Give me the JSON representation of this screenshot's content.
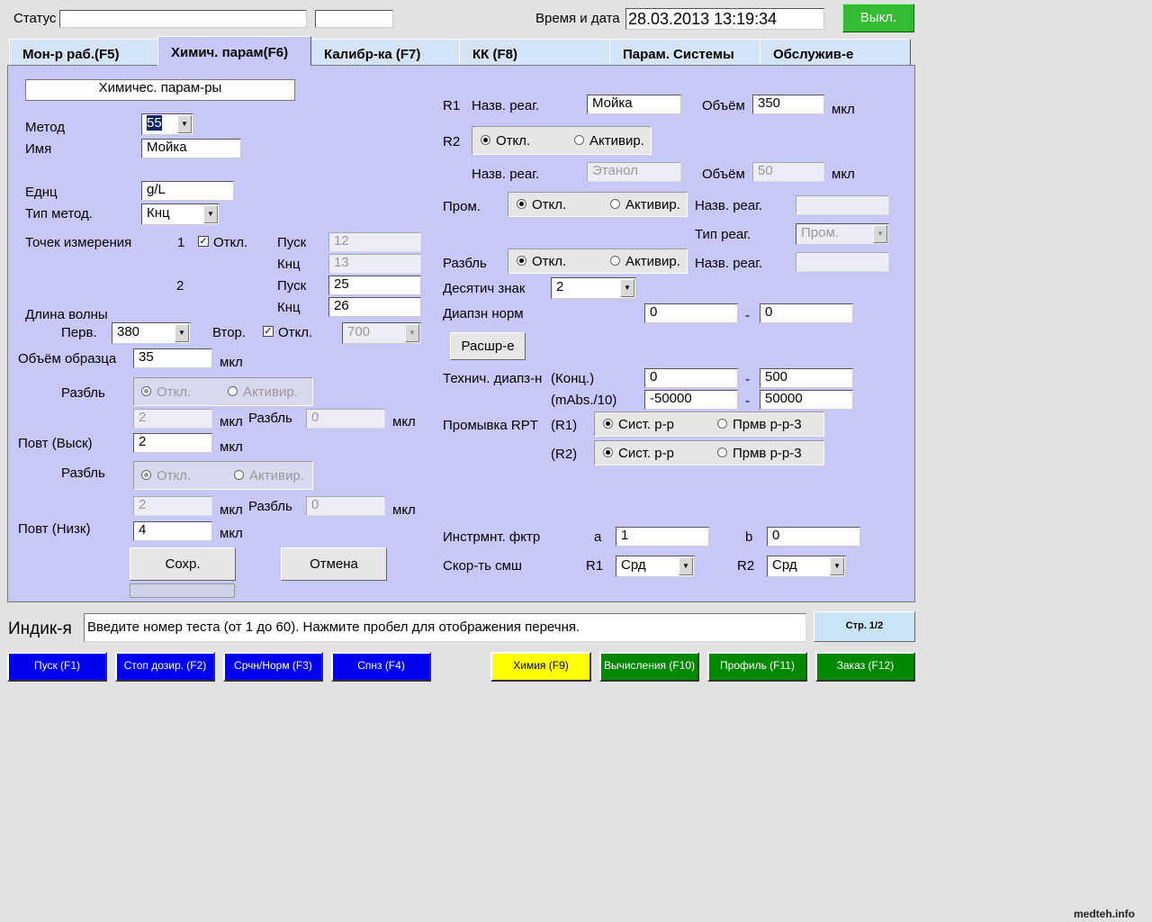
{
  "header": {
    "status_label": "Статус",
    "status_value": "",
    "status_extra": "",
    "datetime_label": "Время и дата",
    "datetime_value": "28.03.2013 13:19:34",
    "power_button": "Выкл."
  },
  "tabs": [
    {
      "label": "Мон-р раб.(F5)"
    },
    {
      "label": "Химич. парам(F6)"
    },
    {
      "label": "Калибр-ка (F7)"
    },
    {
      "label": "КК    (F8)"
    },
    {
      "label": "Парам. Системы"
    },
    {
      "label": "Обслужив-е"
    }
  ],
  "left": {
    "section_title": "Химичес. парам-ры",
    "method_label": "Метод",
    "method_value": "55",
    "name_label": "Имя",
    "name_value": "Мойка",
    "units_label": "Еднц",
    "units_value": "g/L",
    "method_type_label": "Тип метод.",
    "method_type_value": "Кнц",
    "points_label": "Точек измерения",
    "point1": "1",
    "point1_off": "Откл.",
    "start_label": "Пуск",
    "end_label": "Кнц",
    "p1_start": "12",
    "p1_end": "13",
    "point2": "2",
    "p2_start": "25",
    "p2_end": "26",
    "wavelength_label": "Длина волны",
    "primary_label": "Перв.",
    "primary_value": "380",
    "secondary_label": "Втор.",
    "secondary_off": "Откл.",
    "secondary_value": "700",
    "sample_volume_label": "Объём образца",
    "sample_volume_value": "35",
    "unit_ul": "мкл",
    "dilution_label": "Разбль",
    "off": "Откл.",
    "activate": "Активир.",
    "dil1_volume": "2",
    "dil1_dilution": "0",
    "repeat_high_label": "Повт (Выск)",
    "repeat_high_value": "2",
    "dil2_volume": "2",
    "dil2_dilution": "0",
    "repeat_low_label": "Повт (Низк)",
    "repeat_low_value": "4",
    "save_button": "Сохр.",
    "cancel_button": "Отмена"
  },
  "right": {
    "r1_label": "R1",
    "reagent_name_label": "Назв. реаг.",
    "r1_reagent": "Мойка",
    "volume_label": "Объём",
    "r1_volume": "350",
    "unit_ul": "мкл",
    "r2_label": "R2",
    "off": "Откл.",
    "activate": "Активир.",
    "r2_reagent": "Этанол",
    "r2_volume": "50",
    "wash_label": "Пром.",
    "wash_reagent": "",
    "reagent_type_label": "Тип реаг.",
    "reagent_type_value": "Пром.",
    "dilution_label": "Разбль",
    "dilution_reagent": "",
    "decimals_label": "Десятич знак",
    "decimals_value": "2",
    "norm_range_label": "Диапзн норм",
    "norm_low": "0",
    "norm_high": "0",
    "dash": "-",
    "expand_button": "Расшр-е",
    "tech_range_label": "Технич. диапз-н",
    "conc_label": "(Конц.)",
    "conc_low": "0",
    "conc_high": "500",
    "mabs_label": "(mAbs./10)",
    "mabs_low": "-50000",
    "mabs_high": "50000",
    "rpt_wash_label": "Промывка RPT",
    "r1_paren": "(R1)",
    "r2_paren": "(R2)",
    "sys_solution": "Сист. р-р",
    "wash_r3": "Прмв р-р-3",
    "instr_factor_label": "Инстрмнт. фктр",
    "a_label": "a",
    "a_value": "1",
    "b_label": "b",
    "b_value": "0",
    "mix_speed_label": "Скор-ть смш",
    "mix_r1_value": "Срд",
    "mix_r2_value": "Срд"
  },
  "indicator": {
    "label": "Индик-я",
    "message": "Введите номер теста (от 1 до 60).  Нажмите пробел для отображения перечня.",
    "page": "Стр. 1/2"
  },
  "function_keys": [
    {
      "label": "Пуск      (F1)",
      "color": "#0000ee"
    },
    {
      "label": "Стоп дозир. (F2)",
      "color": "#0000ee"
    },
    {
      "label": "Срчн/Норм  (F3)",
      "color": "#0000ee"
    },
    {
      "label": "Спнз       (F4)",
      "color": "#0000ee"
    },
    {
      "label": "Химия (F9)",
      "color": "#ffff00"
    },
    {
      "label": "Вычисления (F10)",
      "color": "#008800"
    },
    {
      "label": "Профиль (F11)",
      "color": "#008800"
    },
    {
      "label": "Заказ (F12)",
      "color": "#008800"
    }
  ],
  "watermark": "medteh.info"
}
